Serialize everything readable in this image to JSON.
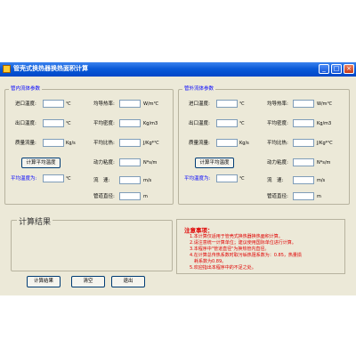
{
  "window": {
    "title": "管壳式换热器换热面积计算"
  },
  "tube_side": {
    "legend": "管内流体参数",
    "inlet_temp": {
      "label": "进口温度:",
      "unit": "℃"
    },
    "outlet_temp": {
      "label": "出口温度:",
      "unit": "℃"
    },
    "mass_flow": {
      "label": "质量流量:",
      "unit": "Kg/s"
    },
    "calc_avg_button": "计算平均温度",
    "avg_temp": {
      "label": "平均温度为:",
      "unit": "℃"
    },
    "thermal_conductivity": {
      "label": "均导热率:",
      "unit": "W/m℃"
    },
    "avg_density": {
      "label": "平均密度:",
      "unit": "Kg/m3"
    },
    "avg_specific_heat": {
      "label": "平均比热:",
      "unit": "J/Kg*℃"
    },
    "dynamic_viscosity": {
      "label": "动力粘度:",
      "unit": "N*s/m"
    },
    "velocity": {
      "label": "流　速:",
      "unit": "m/s"
    },
    "pipe_diameter": {
      "label": "管道直径:",
      "unit": "m"
    }
  },
  "shell_side": {
    "legend": "管外流体参数",
    "inlet_temp": {
      "label": "进口温度:",
      "unit": "℃"
    },
    "outlet_temp": {
      "label": "出口温度:",
      "unit": "℃"
    },
    "mass_flow": {
      "label": "质量流量:",
      "unit": "Kg/s"
    },
    "calc_avg_button": "计算平均温度",
    "avg_temp": {
      "label": "平均温度为:",
      "unit": "℃"
    },
    "thermal_conductivity": {
      "label": "均导热率:",
      "unit": "W/m℃"
    },
    "avg_density": {
      "label": "平均密度:",
      "unit": "Kg/m3"
    },
    "avg_specific_heat": {
      "label": "平均比热:",
      "unit": "J/Kg*℃"
    },
    "dynamic_viscosity": {
      "label": "动力粘度:",
      "unit": "N*s/m"
    },
    "velocity": {
      "label": "流　速:",
      "unit": "m/s"
    },
    "pipe_diameter": {
      "label": "管道直径:",
      "unit": "m"
    }
  },
  "results": {
    "title": "计算结果"
  },
  "notes": {
    "title": "注意事项：",
    "items": [
      "1.本计算仅适用于管壳式换热器换热面积计算。",
      "2.请注意统一计算单位；建议使用国际单位进行计算。",
      "3.本程序中\"管道直径\"为换热管内直径。",
      "4.在计算总传热系数时取污垢热阻系数为：0.85，热量损",
      "　耗系数为0.89。",
      "5.欢迎指出本程序中的不足之处。"
    ]
  },
  "buttons": {
    "calculate": "计算结果",
    "clear": "清空",
    "exit": "退出"
  }
}
